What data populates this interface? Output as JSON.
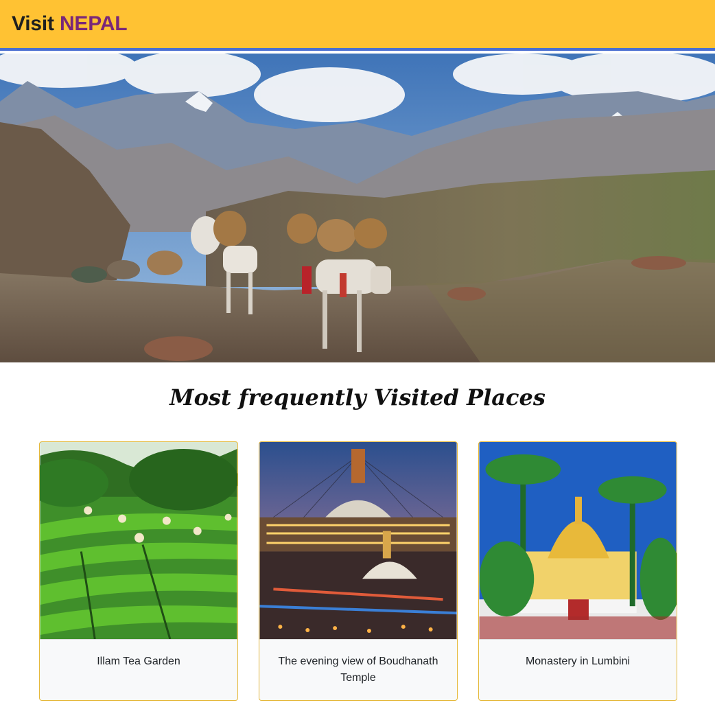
{
  "header": {
    "brand_prefix": "Visit",
    "brand_highlight": "NEPAL",
    "bg_color": "#ffc233",
    "accent_border_color": "#4a6fd1",
    "highlight_color": "#7a2878"
  },
  "hero": {
    "image": "mountain-mule-caravan-photo"
  },
  "main": {
    "section_title": "Most frequently Visited Places"
  },
  "cards": [
    {
      "caption": "Illam Tea Garden",
      "image": "tea-garden-photo"
    },
    {
      "caption": "The evening view of Boudhanath Temple",
      "image": "boudhanath-stupa-photo"
    },
    {
      "caption": "Monastery in Lumbini",
      "image": "lumbini-monastery-photo"
    }
  ]
}
